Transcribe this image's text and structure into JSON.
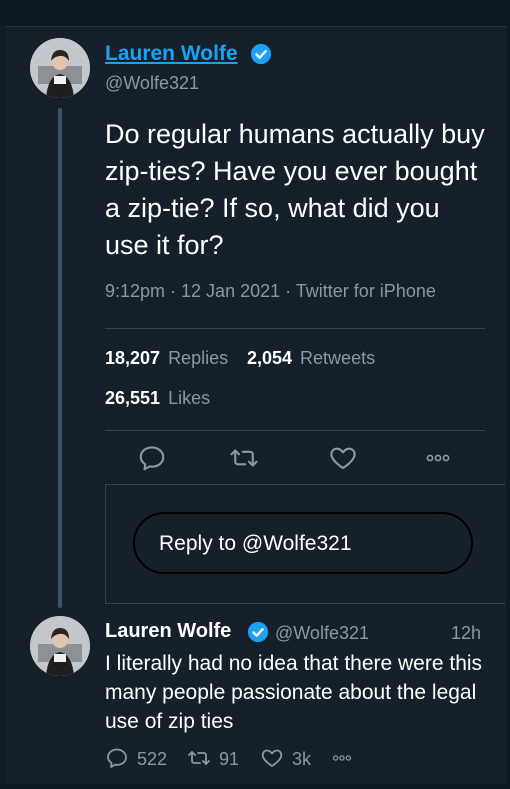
{
  "tweet": {
    "author_name": "Lauren Wolfe",
    "handle": "@Wolfe321",
    "text": "Do regular humans actually buy zip-ties? Have you ever bought a zip-tie? If so, what did you use it for?",
    "meta": "9:12pm · 12 Jan 2021 · Twitter for iPhone",
    "stats": {
      "replies_count": "18,207",
      "replies_label": "Replies",
      "retweets_count": "2,054",
      "retweets_label": "Retweets",
      "likes_count": "26,551",
      "likes_label": "Likes"
    }
  },
  "reply_box": {
    "label": "Reply to @Wolfe321"
  },
  "reply_tweet": {
    "author_name": "Lauren Wolfe",
    "handle": "@Wolfe321",
    "time": "12h",
    "text": "I literally had no idea that there were this many people passionate about the legal use of zip ties",
    "replies": "522",
    "retweets": "91",
    "likes": "3k"
  },
  "colors": {
    "background": "#15202b",
    "accent": "#1da1f2",
    "muted": "#8899a6",
    "border": "#38444d"
  },
  "icons": [
    "verified-badge-icon",
    "reply-icon",
    "retweet-icon",
    "like-icon",
    "more-icon"
  ]
}
